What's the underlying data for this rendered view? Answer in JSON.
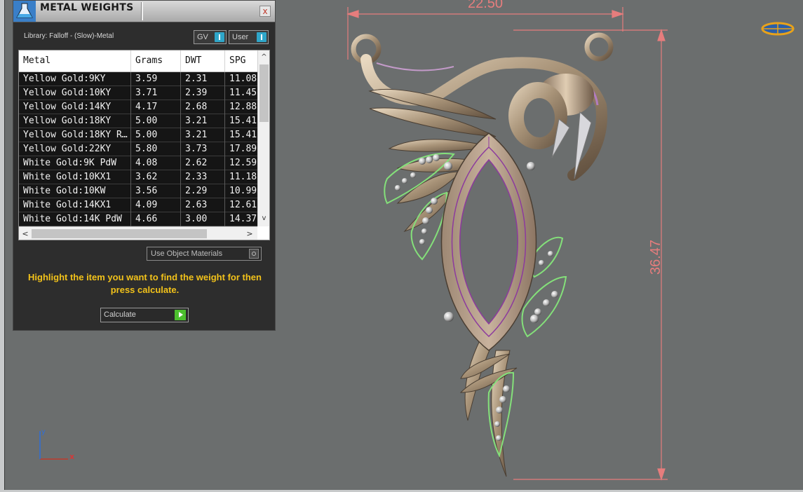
{
  "panel": {
    "title": "METAL WEIGHTS",
    "close_glyph": "x",
    "library_label": "Library: Falloff - (Slow)-Metal",
    "toggles": {
      "gv": "GV",
      "user": "User"
    },
    "table": {
      "headers": [
        "Metal",
        "Grams",
        "DWT",
        "SPG"
      ],
      "rows": [
        [
          "Yellow Gold:9KY",
          "3.59",
          "2.31",
          "11.08"
        ],
        [
          "Yellow Gold:10KY",
          "3.71",
          "2.39",
          "11.45"
        ],
        [
          "Yellow Gold:14KY",
          "4.17",
          "2.68",
          "12.88"
        ],
        [
          "Yellow Gold:18KY",
          "5.00",
          "3.21",
          "15.41"
        ],
        [
          "Yellow Gold:18KY R…",
          "5.00",
          "3.21",
          "15.41"
        ],
        [
          "Yellow Gold:22KY",
          "5.80",
          "3.73",
          "17.89"
        ],
        [
          "White Gold:9K PdW",
          "4.08",
          "2.62",
          "12.59"
        ],
        [
          "White Gold:10KX1",
          "3.62",
          "2.33",
          "11.18"
        ],
        [
          "White Gold:10KW",
          "3.56",
          "2.29",
          "10.99"
        ],
        [
          "White Gold:14KX1",
          "4.09",
          "2.63",
          "12.61"
        ],
        [
          "White Gold:14K PdW",
          "4.66",
          "3.00",
          "14.37"
        ]
      ]
    },
    "scroll": {
      "up": "^",
      "down": "v",
      "left": "<",
      "right": ">"
    },
    "use_object_materials": "Use Object Materials",
    "hint": "Highlight the item you want to find the weight for then press calculate.",
    "calculate": "Calculate"
  },
  "viewport": {
    "dimension_width": "22.50",
    "dimension_height": "36.47",
    "axis_x": "x",
    "axis_y": "y"
  },
  "colors": {
    "panel_bg": "#2d2d2d",
    "hint_text": "#f2c21a",
    "dimension": "#e67d7d",
    "toggle_on": "#2fa6c9",
    "calculate_arrow": "#4cbf2e",
    "viewport_bg": "#6b6e6e"
  }
}
